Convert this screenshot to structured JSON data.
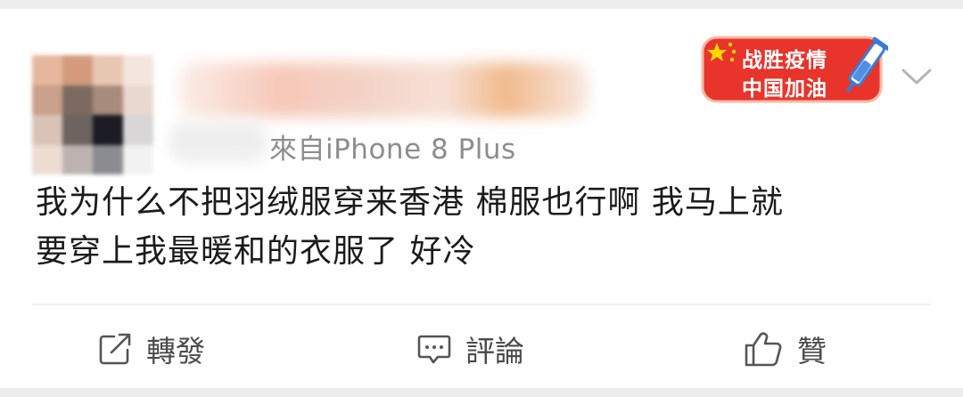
{
  "post": {
    "source": "來自iPhone 8 Plus",
    "badge": {
      "line1": "战胜疫情",
      "line2": "中国加油"
    },
    "content_lines": [
      "我为什么不把羽绒服穿来香港 棉服也行啊 我马上就",
      "要穿上我最暖和的衣服了 好冷"
    ]
  },
  "actions": {
    "repost_label": "轉發",
    "comment_label": "評論",
    "like_label": "贊"
  },
  "icons": {
    "repost": "share-square-icon",
    "comment": "comment-bubble-icon",
    "like": "thumbs-up-icon",
    "more": "chevron-down-icon",
    "flag": "china-flag-icon",
    "syringe": "syringe-icon"
  },
  "colors": {
    "badge_red": "#e8342b",
    "badge_blue": "#3a7bd5",
    "text": "#1b1b1b",
    "muted": "#8d8d8d"
  }
}
